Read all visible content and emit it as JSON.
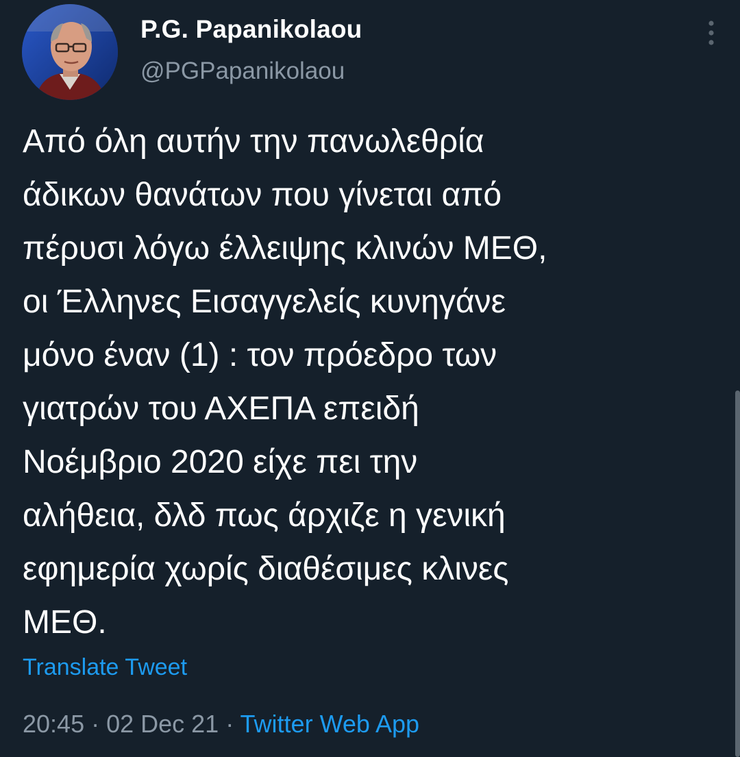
{
  "author": {
    "name": "P.G. Papanikolaou",
    "handle": "@PGPapanikolaou",
    "avatar_icon": "profile-photo"
  },
  "menu": {
    "icon": "more-vertical-icon"
  },
  "tweet": {
    "text": "Από όλη αυτήν την πανωλεθρία\nάδικων θανάτων που γίνεται από\nπέρυσι λόγω έλλειψης κλινών ΜΕΘ,\nοι Έλληνες Εισαγγελείς κυνηγάνε\nμόνο έναν (1) : τον πρόεδρο των\nγιατρών του ΑΧΕΠΑ επειδή\nΝοέμβριο 2020 είχε πει την\nαλήθεια, δλδ πως άρχιζε η γενική\nεφημερία χωρίς διαθέσιμες κλινες\nΜΕΘ.",
    "translate_label": "Translate Tweet"
  },
  "meta": {
    "time": "20:45",
    "separator": " · ",
    "date": "02 Dec 21",
    "source": "Twitter Web App"
  },
  "colors": {
    "background": "#15202b",
    "text": "#ffffff",
    "secondary": "#8b98a5",
    "accent": "#1d9bf0"
  }
}
